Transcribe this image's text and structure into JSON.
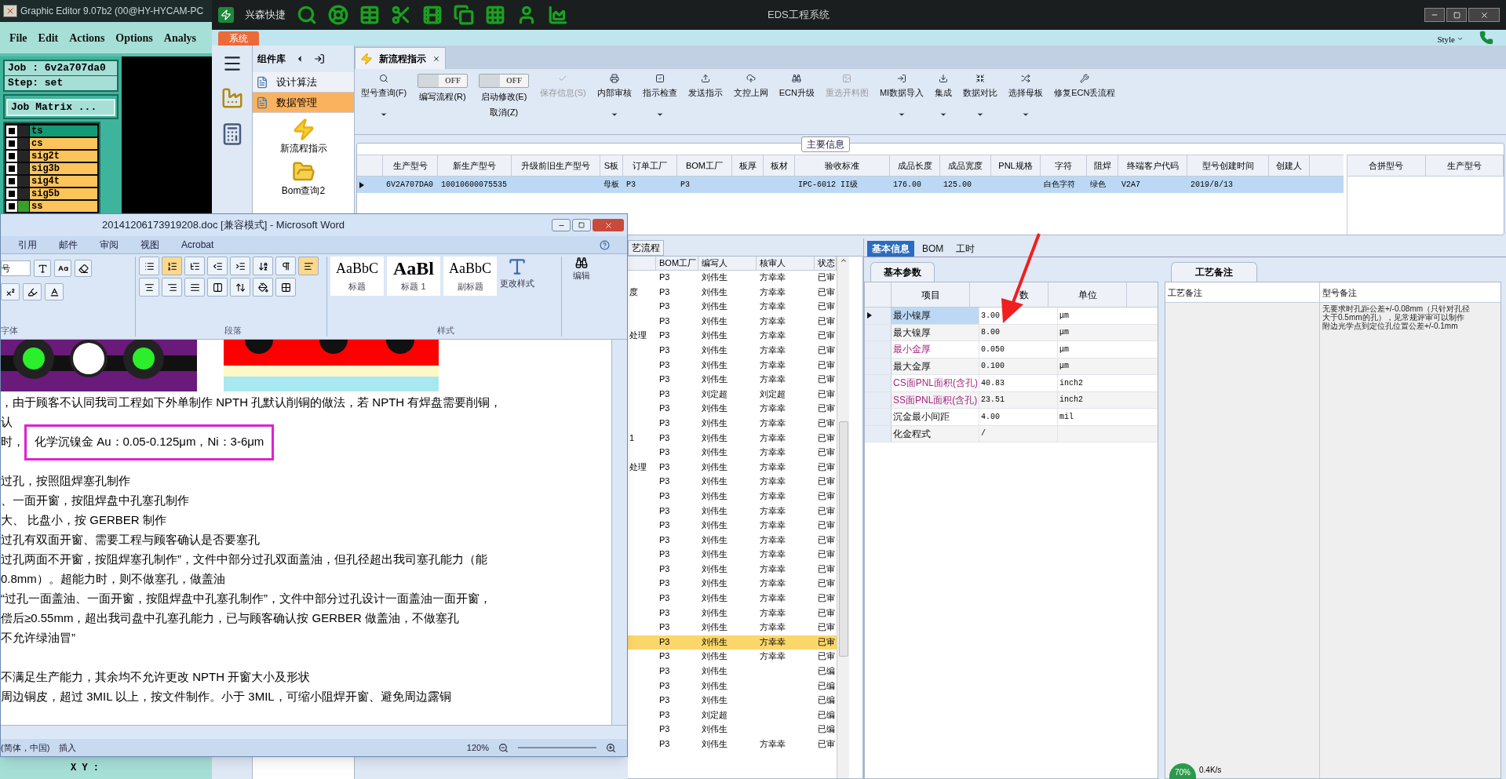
{
  "graphic_editor": {
    "title": "Graphic Editor 9.07b2 (00@HY-HYCAM-PC",
    "menu": [
      "File",
      "Edit",
      "Actions",
      "Options",
      "Analys"
    ],
    "job": "Job : 6v2a707da0",
    "step": "Step: set",
    "job_matrix_button": "Job Matrix ...",
    "layers": [
      {
        "name": "ts",
        "checked": false,
        "marked": false,
        "color": "#139a76"
      },
      {
        "name": "cs",
        "checked": false,
        "marked": false,
        "color": "#fdc45c"
      },
      {
        "name": "sig2t",
        "checked": false,
        "marked": false,
        "color": "#fdc45c"
      },
      {
        "name": "sig3b",
        "checked": false,
        "marked": false,
        "color": "#fdc45c"
      },
      {
        "name": "sig4t",
        "checked": false,
        "marked": false,
        "color": "#fdc45c"
      },
      {
        "name": "sig5b",
        "checked": false,
        "marked": false,
        "color": "#fdc45c"
      },
      {
        "name": "ss",
        "checked": false,
        "marked": true,
        "color": "#fdc45c"
      }
    ],
    "coordinates_label": "X Y :"
  },
  "eds": {
    "title": "EDS工程系统",
    "app_name": "兴森快捷",
    "ribbon_tab": "系统",
    "style_menu": "Style",
    "component_panel": {
      "title": "组件库",
      "items": [
        {
          "label": "设计算法",
          "selected": false
        },
        {
          "label": "数据管理",
          "selected": true
        }
      ],
      "launchers": [
        "新流程指示",
        "Bom查询2"
      ]
    },
    "document_tab": {
      "label": "新流程指示"
    },
    "toolbar": [
      {
        "kind": "button",
        "label": "型号查询(F)",
        "dropdown": true,
        "disabled": false
      },
      {
        "kind": "toggle",
        "label": "编写流程(R)",
        "state_label": "OFF",
        "on": false
      },
      {
        "kind": "toggle",
        "label": "启动修改(E)",
        "sublabel": "取消(Z)",
        "state_label": "OFF",
        "on": false
      },
      {
        "kind": "button",
        "label": "保存信息(S)",
        "dropdown": false,
        "disabled": true
      },
      {
        "kind": "button",
        "label": "内部审核",
        "dropdown": true,
        "disabled": false
      },
      {
        "kind": "button",
        "label": "指示检查",
        "dropdown": true,
        "disabled": false
      },
      {
        "kind": "button",
        "label": "发送指示",
        "dropdown": false,
        "disabled": false
      },
      {
        "kind": "button",
        "label": "文控上网",
        "dropdown": false,
        "disabled": false
      },
      {
        "kind": "button",
        "label": "ECN升级",
        "dropdown": false,
        "disabled": false
      },
      {
        "kind": "button",
        "label": "重选开料图",
        "dropdown": false,
        "disabled": true
      },
      {
        "kind": "button",
        "label": "MI数据导入",
        "dropdown": true,
        "disabled": false
      },
      {
        "kind": "button",
        "label": "集成",
        "dropdown": true,
        "disabled": false
      },
      {
        "kind": "button",
        "label": "数据对比",
        "dropdown": true,
        "disabled": false
      },
      {
        "kind": "button",
        "label": "选择母板",
        "dropdown": true,
        "disabled": false
      },
      {
        "kind": "button",
        "label": "修复ECN丢流程",
        "dropdown": false,
        "disabled": false
      }
    ],
    "main_info": {
      "title": "主要信息",
      "columns": [
        "生产型号",
        "新生产型号",
        "升级前旧生产型号",
        "S板",
        "订单工厂",
        "BOM工厂",
        "板厚",
        "板材",
        "验收标准",
        "成品长度",
        "成品宽度",
        "PNL规格",
        "字符",
        "阻焊",
        "终端客户代码",
        "型号创建时间",
        "创建人"
      ],
      "rows": [
        {
          "selected": true,
          "cells": [
            "6V2A707DA0",
            "10010600075535",
            "",
            "母板",
            "P3",
            "P3",
            "",
            "",
            "IPC-6012 II级",
            "176.00",
            "125.00",
            "",
            "白色字符",
            "绿色",
            "V2A7",
            "2019/8/13",
            ""
          ]
        }
      ],
      "side_columns": [
        "合拼型号",
        "生产型号"
      ]
    },
    "process_list": {
      "tab": "艺流程",
      "columns": [
        "BOM工厂",
        "编写人",
        "核审人",
        "状态"
      ],
      "rows": [
        {
          "column_1": "",
          "cells": [
            "P3",
            "刘伟生",
            "方幸幸",
            "已审"
          ],
          "selected": false
        },
        {
          "column_1": "度",
          "cells": [
            "P3",
            "刘伟生",
            "方幸幸",
            "已审"
          ],
          "selected": false
        },
        {
          "column_1": "",
          "cells": [
            "P3",
            "刘伟生",
            "方幸幸",
            "已审"
          ],
          "selected": false
        },
        {
          "column_1": "",
          "cells": [
            "P3",
            "刘伟生",
            "方幸幸",
            "已审"
          ],
          "selected": false
        },
        {
          "column_1": "处理",
          "cells": [
            "P3",
            "刘伟生",
            "方幸幸",
            "已审"
          ],
          "selected": false
        },
        {
          "column_1": "",
          "cells": [
            "P3",
            "刘伟生",
            "方幸幸",
            "已审"
          ],
          "selected": false
        },
        {
          "column_1": "",
          "cells": [
            "P3",
            "刘伟生",
            "方幸幸",
            "已审"
          ],
          "selected": false
        },
        {
          "column_1": "",
          "cells": [
            "P3",
            "刘伟生",
            "方幸幸",
            "已审"
          ],
          "selected": false
        },
        {
          "column_1": "",
          "cells": [
            "P3",
            "刘定超",
            "刘定超",
            "已审"
          ],
          "selected": false
        },
        {
          "column_1": "",
          "cells": [
            "P3",
            "刘伟生",
            "方幸幸",
            "已审"
          ],
          "selected": false
        },
        {
          "column_1": "",
          "cells": [
            "P3",
            "刘伟生",
            "方幸幸",
            "已审"
          ],
          "selected": false
        },
        {
          "column_1": "1",
          "cells": [
            "P3",
            "刘伟生",
            "方幸幸",
            "已审"
          ],
          "selected": false
        },
        {
          "column_1": "",
          "cells": [
            "P3",
            "刘伟生",
            "方幸幸",
            "已审"
          ],
          "selected": false
        },
        {
          "column_1": "处理",
          "cells": [
            "P3",
            "刘伟生",
            "方幸幸",
            "已审"
          ],
          "selected": false
        },
        {
          "column_1": "",
          "cells": [
            "P3",
            "刘伟生",
            "方幸幸",
            "已审"
          ],
          "selected": false
        },
        {
          "column_1": "",
          "cells": [
            "P3",
            "刘伟生",
            "方幸幸",
            "已审"
          ],
          "selected": false
        },
        {
          "column_1": "",
          "cells": [
            "P3",
            "刘伟生",
            "方幸幸",
            "已审"
          ],
          "selected": false
        },
        {
          "column_1": "",
          "cells": [
            "P3",
            "刘伟生",
            "方幸幸",
            "已审"
          ],
          "selected": false
        },
        {
          "column_1": "",
          "cells": [
            "P3",
            "刘伟生",
            "方幸幸",
            "已审"
          ],
          "selected": false
        },
        {
          "column_1": "",
          "cells": [
            "P3",
            "刘伟生",
            "方幸幸",
            "已审"
          ],
          "selected": false
        },
        {
          "column_1": "",
          "cells": [
            "P3",
            "刘伟生",
            "方幸幸",
            "已审"
          ],
          "selected": false
        },
        {
          "column_1": "",
          "cells": [
            "P3",
            "刘伟生",
            "方幸幸",
            "已审"
          ],
          "selected": false
        },
        {
          "column_1": "",
          "cells": [
            "P3",
            "刘伟生",
            "方幸幸",
            "已审"
          ],
          "selected": false
        },
        {
          "column_1": "",
          "cells": [
            "P3",
            "刘伟生",
            "方幸幸",
            "已审"
          ],
          "selected": false
        },
        {
          "column_1": "",
          "cells": [
            "P3",
            "刘伟生",
            "方幸幸",
            "已审"
          ],
          "selected": false
        },
        {
          "column_1": "",
          "cells": [
            "P3",
            "刘伟生",
            "方幸幸",
            "已审"
          ],
          "selected": true
        },
        {
          "column_1": "",
          "cells": [
            "P3",
            "刘伟生",
            "方幸幸",
            "已审"
          ],
          "selected": false
        },
        {
          "column_1": "",
          "cells": [
            "P3",
            "刘伟生",
            "",
            "已编"
          ],
          "selected": false
        },
        {
          "column_1": "",
          "cells": [
            "P3",
            "刘伟生",
            "",
            "已编"
          ],
          "selected": false
        },
        {
          "column_1": "",
          "cells": [
            "P3",
            "刘伟生",
            "",
            "已编"
          ],
          "selected": false
        },
        {
          "column_1": "",
          "cells": [
            "P3",
            "刘定超",
            "",
            "已编"
          ],
          "selected": false
        },
        {
          "column_1": "",
          "cells": [
            "P3",
            "刘伟生",
            "",
            "已编"
          ],
          "selected": false
        },
        {
          "column_1": "",
          "cells": [
            "P3",
            "刘伟生",
            "方幸幸",
            "已审"
          ],
          "selected": false
        }
      ]
    },
    "detail_tabs": [
      {
        "label": "基本信息",
        "selected": true
      },
      {
        "label": "BOM",
        "selected": false
      },
      {
        "label": "工时",
        "selected": false
      }
    ],
    "basic_params": {
      "tab": "基本参数",
      "columns": [
        "项目",
        "数",
        "单位"
      ],
      "rows": [
        {
          "item": "最小镍厚",
          "value": "3.00",
          "unit": "μm",
          "highlighted": false,
          "selected": true
        },
        {
          "item": "最大镍厚",
          "value": "8.00",
          "unit": "μm",
          "highlighted": false,
          "selected": false
        },
        {
          "item": "最小金厚",
          "value": "0.050",
          "unit": "μm",
          "highlighted": true,
          "selected": false
        },
        {
          "item": "最大金厚",
          "value": "0.100",
          "unit": "μm",
          "highlighted": false,
          "selected": false
        },
        {
          "item": "CS面PNL面积(含孔)",
          "value": "40.83",
          "unit": "inch2",
          "highlighted": true,
          "selected": false
        },
        {
          "item": "SS面PNL面积(含孔)",
          "value": "23.51",
          "unit": "inch2",
          "highlighted": true,
          "selected": false
        },
        {
          "item": "沉金最小间距",
          "value": "4.00",
          "unit": "mil",
          "highlighted": false,
          "selected": false
        },
        {
          "item": "化金程式",
          "value": "/",
          "unit": "",
          "highlighted": false,
          "selected": false
        }
      ]
    },
    "process_notes": {
      "tab": "工艺备注",
      "columns": [
        "工艺备注",
        "型号备注"
      ],
      "model_note": [
        "无要求时孔距公差+/-0.08mm（只针对孔径大于0.5mm的孔），见常规评审可以制作",
        "附边光学点到定位孔位置公差+/-0.1mm"
      ]
    },
    "network_widget": {
      "percent": "70%",
      "speed": "0.4K/s"
    }
  },
  "word": {
    "title": "20141206173919208.doc [兼容模式] - Microsoft Word",
    "tabs": [
      "引用",
      "邮件",
      "审阅",
      "视图",
      "Acrobat"
    ],
    "font_size_field": "号",
    "groups": [
      "字体",
      "段落",
      "样式"
    ],
    "styles": [
      {
        "preview": "AaBbC",
        "name": "标题",
        "kind": "normal"
      },
      {
        "preview": "AaBl",
        "name": "标题 1",
        "kind": "heading"
      },
      {
        "preview": "AaBbC",
        "name": "副标题",
        "kind": "normal"
      }
    ],
    "change_styles": "更改样式",
    "edit_button": "编辑",
    "lines": [
      {
        "kind": "text",
        "text": "，由于顾客不认同我司工程如下外单制作 NPTH 孔默认削铜的做法，若 NPTH 有焊盘需要削铜，"
      },
      {
        "kind": "text",
        "text": "认"
      },
      {
        "kind": "boxed",
        "lead": "时，",
        "text": "化学沉镍金 Au：0.05-0.125μm，Ni：3-6μm"
      },
      {
        "kind": "blank"
      },
      {
        "kind": "text",
        "text": "过孔，按照阻焊塞孔制作"
      },
      {
        "kind": "text",
        "text": "、一面开窗，按阻焊盘中孔塞孔制作"
      },
      {
        "kind": "text",
        "text": "大、 比盘小，按 GERBER 制作"
      },
      {
        "kind": "text",
        "text": "过孔有双面开窗、需要工程与顾客确认是否要塞孔"
      },
      {
        "kind": "text",
        "text": "过孔两面不开窗，按阻焊塞孔制作”，文件中部分过孔双面盖油，但孔径超出我司塞孔能力（能"
      },
      {
        "kind": "text",
        "text": "0.8mm）。超能力时，则不做塞孔，做盖油"
      },
      {
        "kind": "text",
        "text": "“过孔一面盖油、一面开窗，按阻焊盘中孔塞孔制作”，文件中部分过孔设计一面盖油一面开窗，"
      },
      {
        "kind": "text",
        "text": "偿后≥0.55mm，超出我司盘中孔塞孔能力，已与顾客确认按 GERBER 做盖油，不做塞孔"
      },
      {
        "kind": "text",
        "text": "不允许绿油冒”"
      },
      {
        "kind": "blank"
      },
      {
        "kind": "text",
        "text": "不满足生产能力，其余均不允许更改 NPTH 开窗大小及形状"
      },
      {
        "kind": "text",
        "text": "周边铜皮，超过 3MIL 以上，按文件制作。小于 3MIL，可缩小阻焊开窗、避免周边露铜"
      }
    ],
    "status": {
      "language": "(简体，中国)",
      "mode": "插入",
      "zoom": "120%"
    }
  }
}
